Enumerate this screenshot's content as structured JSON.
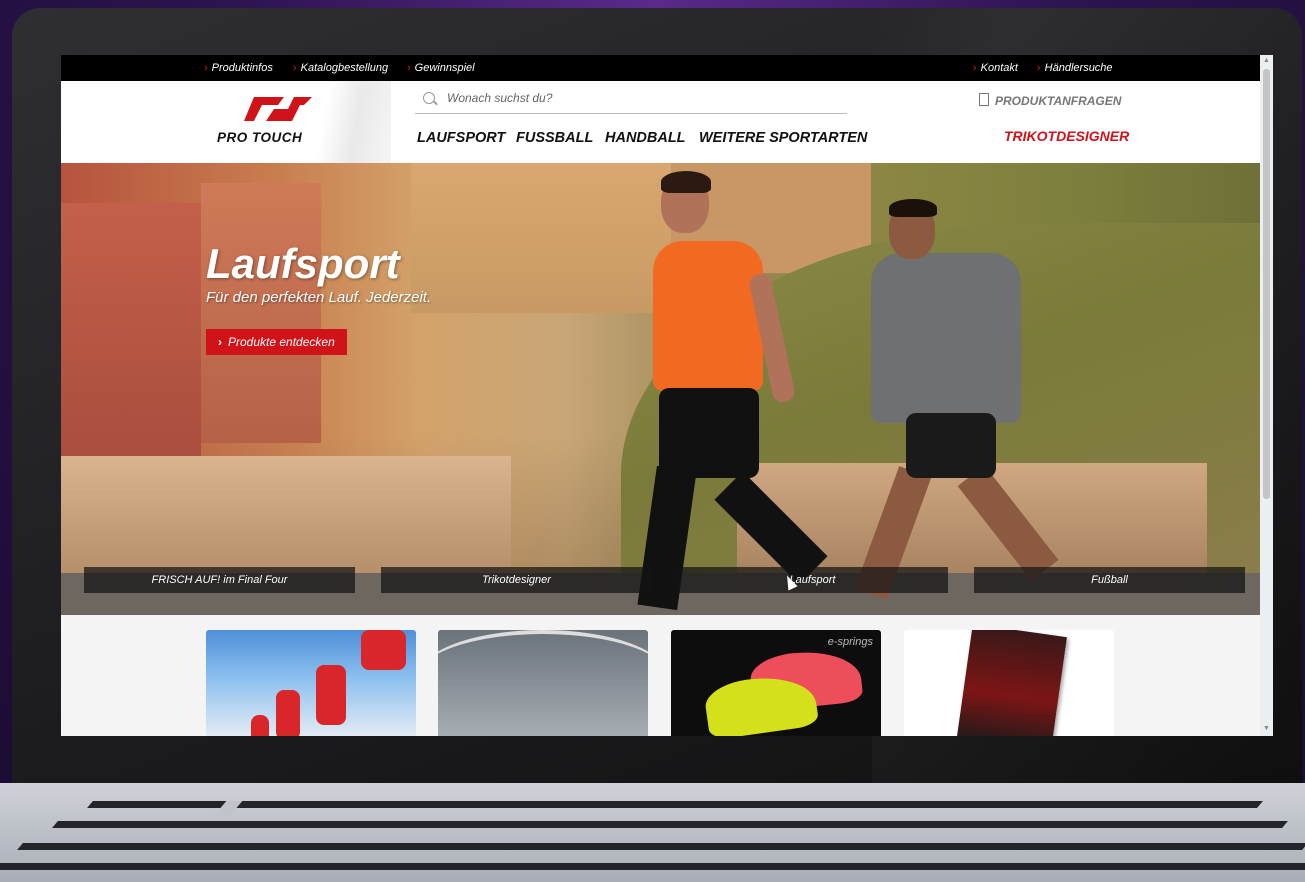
{
  "topbar": {
    "left_links": [
      "Produktinfos",
      "Katalogbestellung",
      "Gewinnspiel"
    ],
    "right_links": [
      "Kontakt",
      "Händlersuche"
    ]
  },
  "header": {
    "logo_text": "PRO TOUCH",
    "search_placeholder": "Wonach suchst du?",
    "nav": [
      "LAUFSPORT",
      "FUSSBALL",
      "HANDBALL",
      "WEITERE SPORTARTEN"
    ],
    "product_requests": "PRODUKTANFRAGEN",
    "trikotdesigner": "TRIKOTDESIGNER"
  },
  "hero": {
    "title": "Laufsport",
    "subtitle": "Für den perfekten Lauf. Jederzeit.",
    "button": "Produkte entdecken",
    "slides": [
      "FRISCH AUF! im Final Four",
      "Trikotdesigner",
      "Laufsport",
      "Fußball"
    ]
  },
  "teasers": {
    "shoe_brand": "e-springs"
  },
  "colors": {
    "accent": "#d01219",
    "topbar": "#000000",
    "background": "#2c1450"
  }
}
